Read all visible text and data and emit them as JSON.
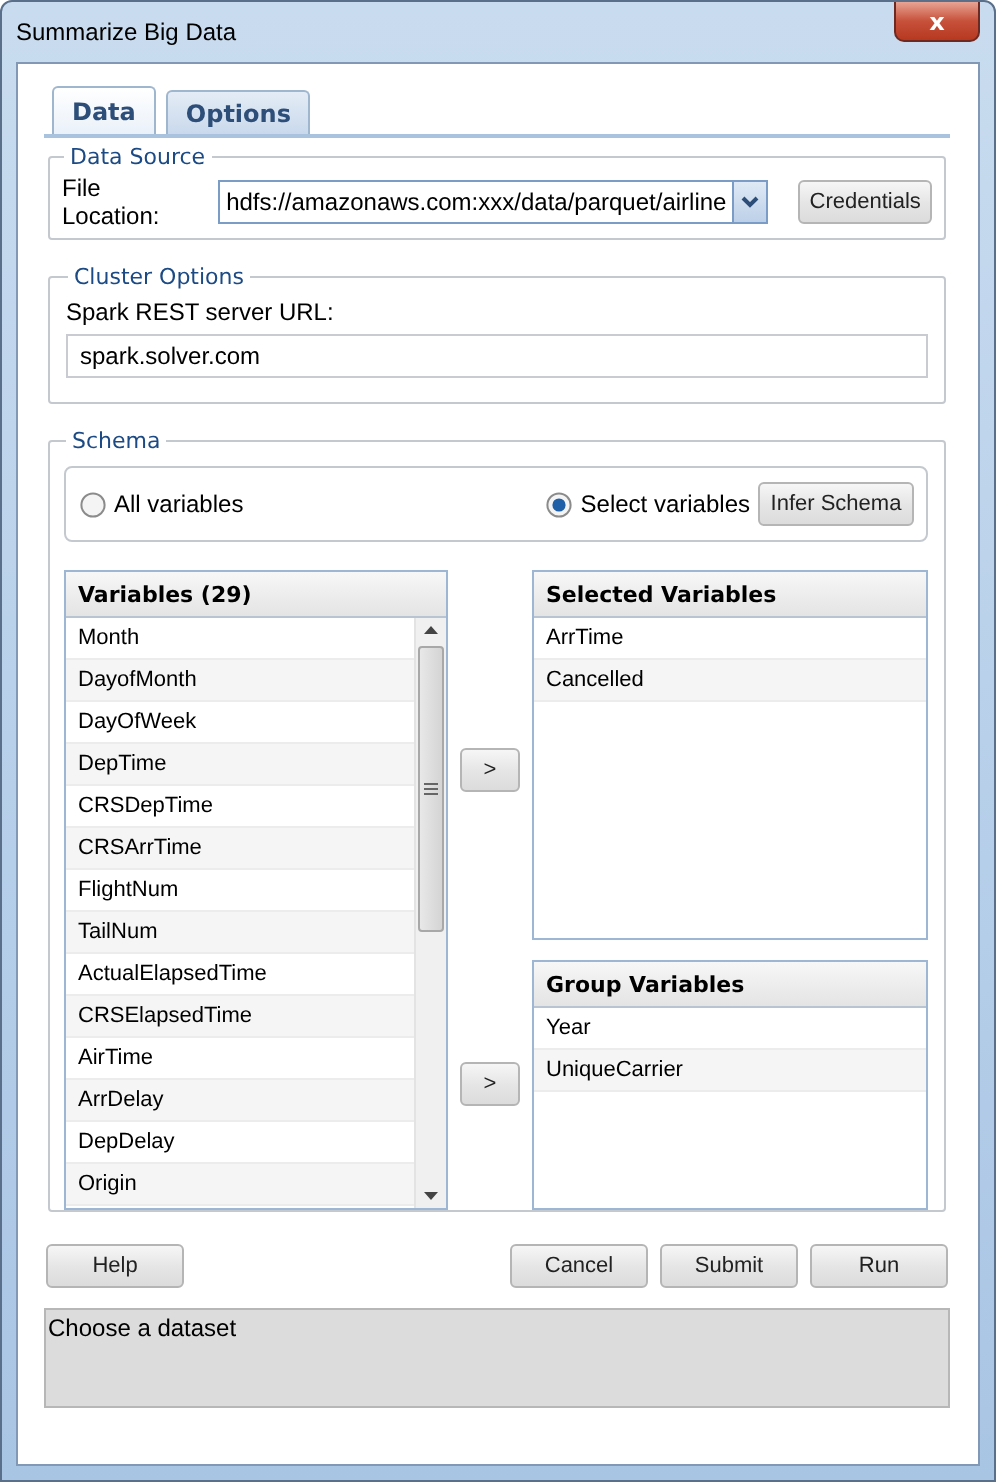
{
  "window": {
    "title": "Summarize Big Data",
    "close": "x"
  },
  "tabs": [
    {
      "label": "Data",
      "selected": true
    },
    {
      "label": "Options",
      "selected": false
    }
  ],
  "data_source": {
    "legend": "Data Source",
    "label": "File Location:",
    "value": "hdfs://amazonaws.com:xxx/data/parquet/airline",
    "button": "Credentials"
  },
  "cluster_options": {
    "legend": "Cluster Options",
    "label": "Spark REST server URL:",
    "value": "spark.solver.com"
  },
  "schema": {
    "legend": "Schema",
    "radios": [
      {
        "label": "All variables",
        "selected": false
      },
      {
        "label": "Select variables",
        "selected": true
      }
    ],
    "infer_button": "Infer Schema",
    "variables": {
      "header": "Variables (29)",
      "items": [
        "Month",
        "DayofMonth",
        "DayOfWeek",
        "DepTime",
        "CRSDepTime",
        "CRSArrTime",
        "FlightNum",
        "TailNum",
        "ActualElapsedTime",
        "CRSElapsedTime",
        "AirTime",
        "ArrDelay",
        "DepDelay",
        "Origin"
      ]
    },
    "move_buttons": [
      ">",
      ">"
    ],
    "selected_variables": {
      "header": "Selected Variables",
      "items": [
        "ArrTime",
        "Cancelled"
      ]
    },
    "group_variables": {
      "header": "Group Variables",
      "items": [
        "Year",
        "UniqueCarrier"
      ]
    }
  },
  "buttons": {
    "help": "Help",
    "actions": [
      "Cancel",
      "Submit",
      "Run"
    ]
  },
  "status": "Choose a dataset"
}
